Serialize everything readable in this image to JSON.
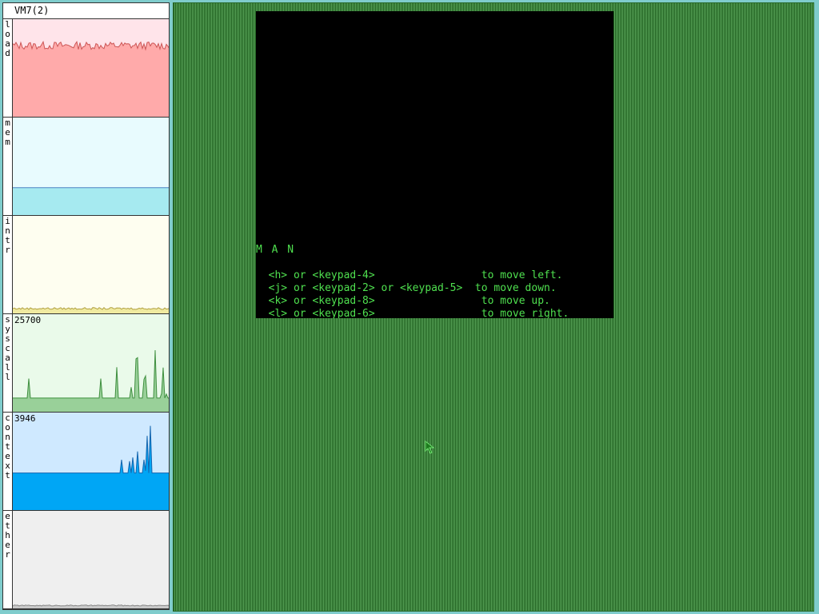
{
  "stats": {
    "title": "VM7(2)",
    "panels": [
      {
        "id": "load",
        "label": "load",
        "max": "",
        "top_color": "#ffe4ea",
        "fill_color": "#ffaaaa",
        "line_color": "#cc5555"
      },
      {
        "id": "mem",
        "label": "mem",
        "max": "",
        "top_color": "#e8fbfe",
        "fill_color": "#a6eaf0",
        "line_color": "#4b82c4"
      },
      {
        "id": "intr",
        "label": "intr",
        "max": "",
        "top_color": "#fefef0",
        "fill_color": "#f0eaa0",
        "line_color": "#b0a040"
      },
      {
        "id": "syscall",
        "label": "syscall",
        "max": "25700",
        "top_color": "#eafaea",
        "fill_color": "#99d099",
        "line_color": "#3f8f3f"
      },
      {
        "id": "context",
        "label": "context",
        "max": "3946",
        "top_color": "#cfe9ff",
        "fill_color": "#00a6f5",
        "line_color": "#1466b0"
      },
      {
        "id": "ether",
        "label": "ether",
        "max": "",
        "top_color": "#efefef",
        "fill_color": "#c8c8c8",
        "line_color": "#888888"
      }
    ]
  },
  "game": {
    "title": "M A N",
    "lines": [
      "  <h> or <keypad-4>                 to move left.",
      "  <j> or <keypad-2> or <keypad-5>  to move down.",
      "  <k> or <keypad-8>                 to move up.",
      "  <l> or <keypad-6>                 to move right."
    ]
  },
  "colors": {
    "terminal_text": "#4fe04f",
    "terminal_bg": "#000000",
    "desktop_bg": "#2f7a2f",
    "frame_bg": "#7fcccc"
  },
  "icons": {
    "cursor": "arrow-pointer-icon"
  }
}
